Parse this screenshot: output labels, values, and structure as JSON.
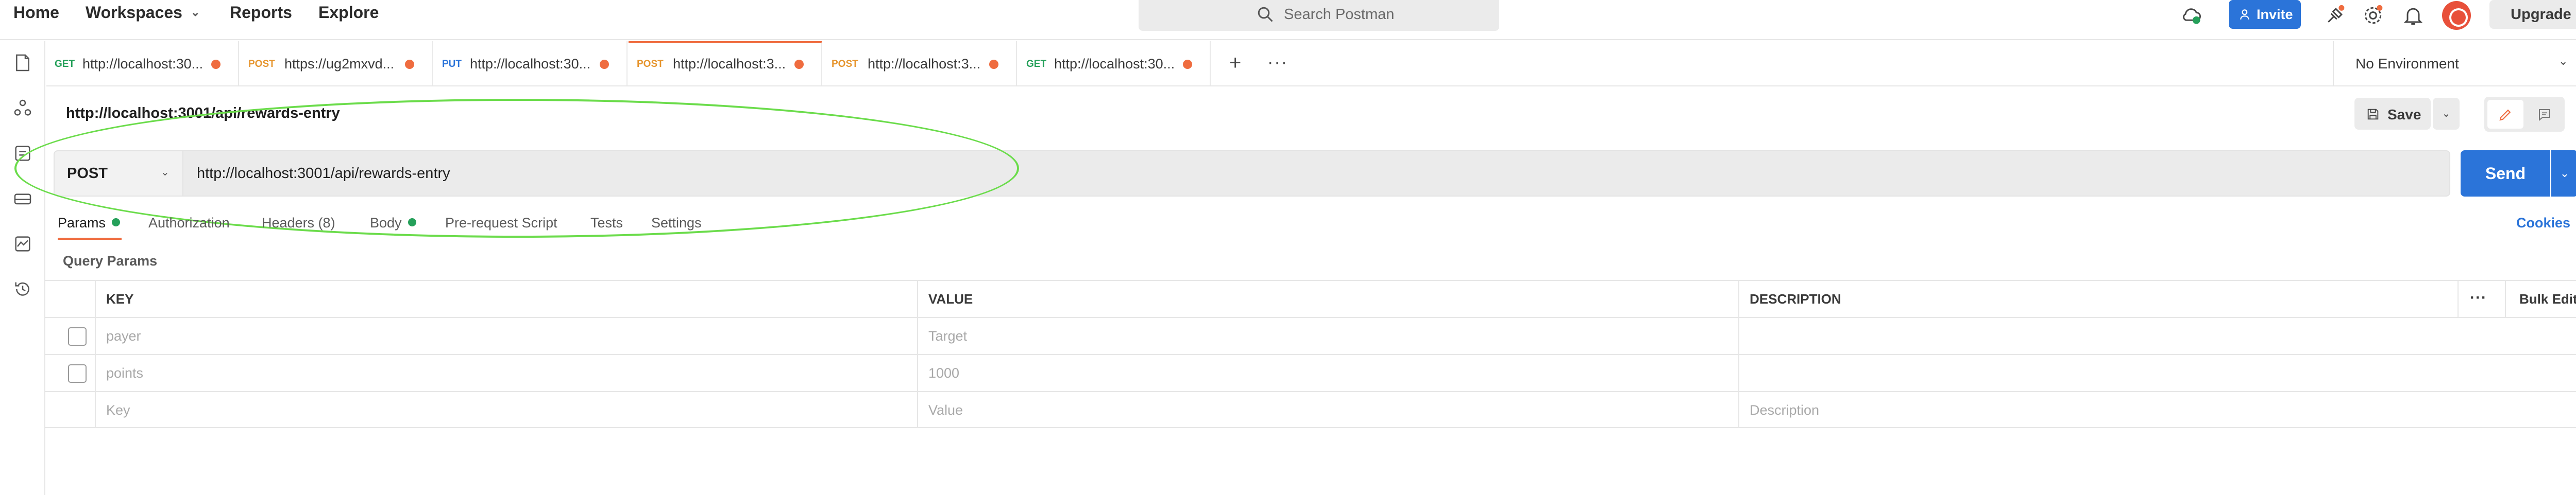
{
  "nav": {
    "home": "Home",
    "workspaces": "Workspaces",
    "reports": "Reports",
    "explore": "Explore",
    "search_placeholder": "Search Postman",
    "invite": "Invite",
    "upgrade": "Upgrade"
  },
  "tabs": [
    {
      "method": "GET",
      "url": "http://localhost:30...",
      "method_color": "#25a05a"
    },
    {
      "method": "POST",
      "url": "https://ug2mxvd...",
      "method_color": "#e6952e"
    },
    {
      "method": "PUT",
      "url": "http://localhost:30...",
      "method_color": "#2b74d9"
    },
    {
      "method": "POST",
      "url": "http://localhost:3...",
      "method_color": "#e6952e",
      "active": true
    },
    {
      "method": "POST",
      "url": "http://localhost:3...",
      "method_color": "#e6952e"
    },
    {
      "method": "GET",
      "url": "http://localhost:30...",
      "method_color": "#25a05a"
    }
  ],
  "environment": "No Environment",
  "request": {
    "title": "http://localhost:3001/api/rewards-entry",
    "method": "POST",
    "url": "http://localhost:3001/api/rewards-entry",
    "save": "Save",
    "send": "Send"
  },
  "request_tabs": {
    "params": "Params",
    "authorization": "Authorization",
    "headers": "Headers (8)",
    "body": "Body",
    "pre_request": "Pre-request Script",
    "tests": "Tests",
    "settings": "Settings",
    "cookies": "Cookies"
  },
  "query_params": {
    "title": "Query Params",
    "columns": {
      "key": "KEY",
      "value": "VALUE",
      "description": "DESCRIPTION",
      "bulk_edit": "Bulk Edit"
    },
    "rows": [
      {
        "key": "payer",
        "value": "Target",
        "description": ""
      },
      {
        "key": "points",
        "value": "1000",
        "description": ""
      }
    ],
    "placeholder": {
      "key": "Key",
      "value": "Value",
      "description": "Description"
    }
  },
  "colors": {
    "accent": "#ef6c3f",
    "primary": "#2b74d9",
    "annotation": "#6bdc4b"
  },
  "icons": {
    "search": "search-icon",
    "invite": "person-add-icon",
    "sync": "satellite-sync-icon",
    "settings": "gear-icon",
    "notifications": "bell-icon",
    "save": "save-icon",
    "edit": "pencil-icon",
    "comments": "comment-icon",
    "code": "code-icon",
    "bulb": "lightbulb-icon"
  }
}
